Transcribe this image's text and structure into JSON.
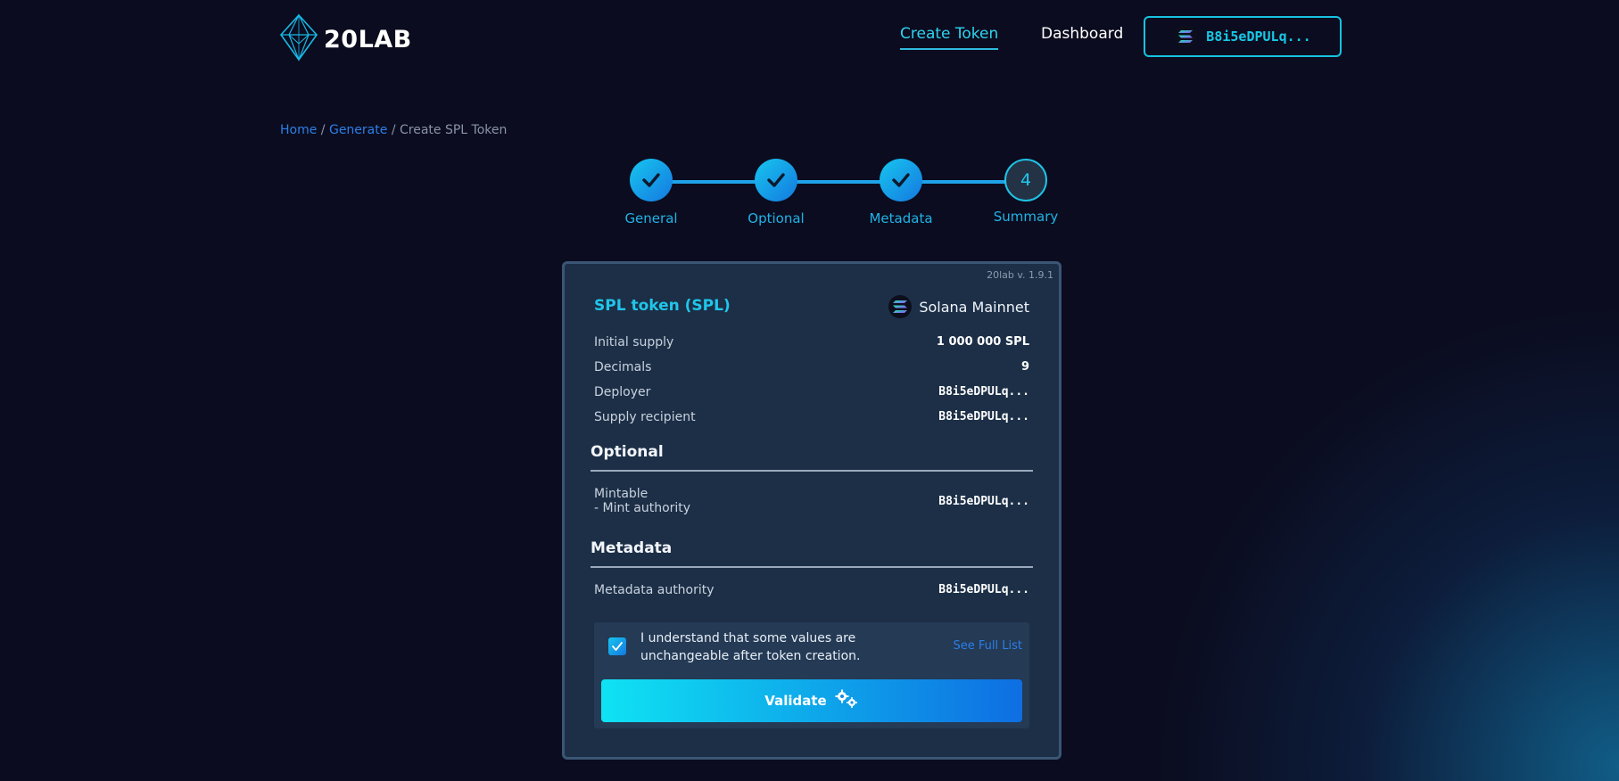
{
  "colors": {
    "accent_cyan": "#20c6e9",
    "link_blue": "#2c7fe8",
    "background": "#0b0c1f",
    "card_bg": "#1c2f47"
  },
  "header": {
    "logo_text": "20LAB",
    "nav": [
      {
        "label": "Create Token",
        "active": true
      },
      {
        "label": "Dashboard",
        "active": false
      }
    ],
    "wallet_label": "B8i5eDPULq...",
    "wallet_icon": "solana-icon"
  },
  "breadcrumb": {
    "items": [
      "Home",
      "Generate",
      "Create SPL Token"
    ],
    "separator": "/"
  },
  "stepper": {
    "steps": [
      {
        "label": "General",
        "status": "done",
        "icon": "check-icon"
      },
      {
        "label": "Optional",
        "status": "done",
        "icon": "check-icon"
      },
      {
        "label": "Metadata",
        "status": "done",
        "icon": "check-icon"
      },
      {
        "label": "Summary",
        "status": "current",
        "number": "4"
      }
    ]
  },
  "summary": {
    "version": "20lab v. 1.9.1",
    "token_title": "SPL token (SPL)",
    "network": "Solana Mainnet",
    "general_rows": [
      {
        "label": "Initial supply",
        "value": "1 000 000 SPL"
      },
      {
        "label": "Decimals",
        "value": "9"
      },
      {
        "label": "Deployer",
        "value": "B8i5eDPULq..."
      },
      {
        "label": "Supply recipient",
        "value": "B8i5eDPULq..."
      }
    ],
    "optional_title": "Optional",
    "optional_rows": [
      {
        "label_line1": "Mintable",
        "label_line2": "- Mint authority",
        "value": "B8i5eDPULq..."
      }
    ],
    "metadata_title": "Metadata",
    "metadata_rows": [
      {
        "label": "Metadata authority",
        "value": "B8i5eDPULq..."
      }
    ],
    "confirm": {
      "checked": true,
      "text": "I understand that some values are unchangeable after token creation.",
      "link": "See Full List"
    },
    "validate_label": "Validate",
    "validate_icon": "gears-icon"
  }
}
